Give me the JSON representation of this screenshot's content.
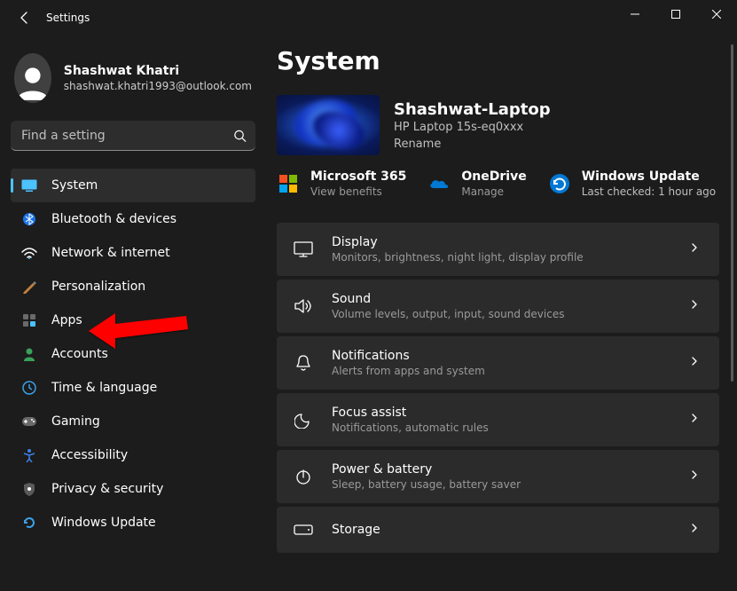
{
  "window": {
    "title": "Settings"
  },
  "profile": {
    "name": "Shashwat Khatri",
    "email": "shashwat.khatri1993@outlook.com"
  },
  "search": {
    "placeholder": "Find a setting"
  },
  "nav": [
    {
      "icon": "system",
      "label": "System",
      "active": true
    },
    {
      "icon": "bluetooth",
      "label": "Bluetooth & devices"
    },
    {
      "icon": "network",
      "label": "Network & internet"
    },
    {
      "icon": "personalization",
      "label": "Personalization"
    },
    {
      "icon": "apps",
      "label": "Apps"
    },
    {
      "icon": "accounts",
      "label": "Accounts"
    },
    {
      "icon": "time",
      "label": "Time & language"
    },
    {
      "icon": "gaming",
      "label": "Gaming"
    },
    {
      "icon": "accessibility",
      "label": "Accessibility"
    },
    {
      "icon": "privacy",
      "label": "Privacy & security"
    },
    {
      "icon": "update",
      "label": "Windows Update"
    }
  ],
  "page": {
    "title": "System"
  },
  "device": {
    "name": "Shashwat-Laptop",
    "model": "HP Laptop 15s-eq0xxx",
    "rename": "Rename"
  },
  "quick": [
    {
      "icon": "m365",
      "title": "Microsoft 365",
      "sub": "View benefits"
    },
    {
      "icon": "onedrive",
      "title": "OneDrive",
      "sub": "Manage"
    },
    {
      "icon": "winupdate",
      "title": "Windows Update",
      "sub": "Last checked: 1 hour ago"
    }
  ],
  "cards": [
    {
      "icon": "display",
      "title": "Display",
      "sub": "Monitors, brightness, night light, display profile"
    },
    {
      "icon": "sound",
      "title": "Sound",
      "sub": "Volume levels, output, input, sound devices"
    },
    {
      "icon": "notifications",
      "title": "Notifications",
      "sub": "Alerts from apps and system"
    },
    {
      "icon": "focus",
      "title": "Focus assist",
      "sub": "Notifications, automatic rules"
    },
    {
      "icon": "power",
      "title": "Power & battery",
      "sub": "Sleep, battery usage, battery saver"
    },
    {
      "icon": "storage",
      "title": "Storage",
      "sub": ""
    }
  ],
  "annotation": {
    "target": "Apps"
  }
}
